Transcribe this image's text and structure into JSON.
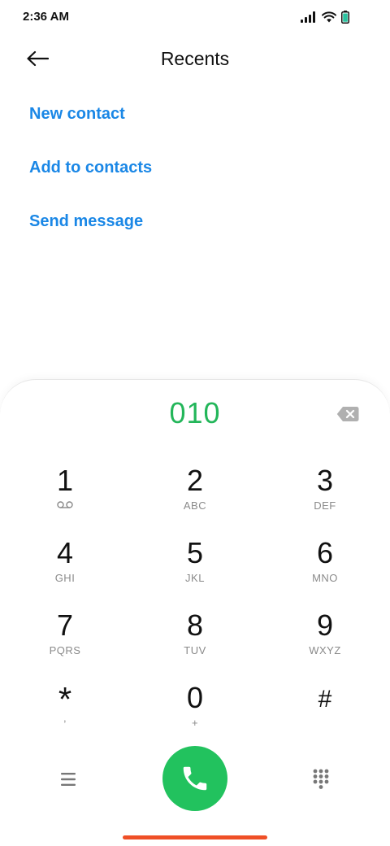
{
  "status": {
    "time": "2:36 AM"
  },
  "header": {
    "title": "Recents"
  },
  "actions": [
    {
      "label": "New contact"
    },
    {
      "label": "Add to contacts"
    },
    {
      "label": "Send message"
    }
  ],
  "dialer": {
    "number": "010"
  },
  "keypad": [
    {
      "digit": "1",
      "letters": ""
    },
    {
      "digit": "2",
      "letters": "ABC"
    },
    {
      "digit": "3",
      "letters": "DEF"
    },
    {
      "digit": "4",
      "letters": "GHI"
    },
    {
      "digit": "5",
      "letters": "JKL"
    },
    {
      "digit": "6",
      "letters": "MNO"
    },
    {
      "digit": "7",
      "letters": "PQRS"
    },
    {
      "digit": "8",
      "letters": "TUV"
    },
    {
      "digit": "9",
      "letters": "WXYZ"
    },
    {
      "digit": "*",
      "letters": ","
    },
    {
      "digit": "0",
      "letters": "+"
    },
    {
      "digit": "#",
      "letters": ""
    }
  ],
  "icons": {
    "back": "back-arrow-icon",
    "delete": "backspace-icon",
    "voicemail": "voicemail-icon",
    "menu": "menu-icon",
    "call": "phone-icon",
    "keypad_toggle": "dialpad-icon"
  },
  "colors": {
    "accent_blue": "#1a87e6",
    "dialed_green": "#23b65a",
    "call_green": "#22c25e",
    "home_indicator": "#ef4f26",
    "secondary_text": "#8a8a8a"
  }
}
